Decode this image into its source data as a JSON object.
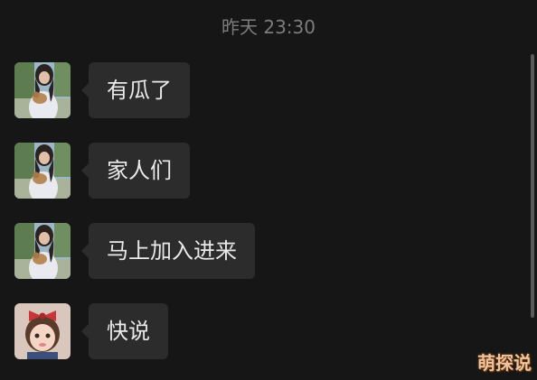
{
  "header": {
    "timestamp": "昨天 23:30"
  },
  "messages": [
    {
      "text": "有瓜了",
      "avatar": "woman-holding-puppy-avatar"
    },
    {
      "text": "家人们",
      "avatar": "woman-holding-puppy-avatar"
    },
    {
      "text": "马上加入进来",
      "avatar": "woman-holding-puppy-avatar"
    },
    {
      "text": "快说",
      "avatar": "child-with-red-bow-avatar"
    }
  ],
  "watermark": "萌探说",
  "colors": {
    "background": "#161616",
    "bubble": "#2c2c2c",
    "text": "#eaeaea",
    "timestamp": "#7c7c7c"
  }
}
